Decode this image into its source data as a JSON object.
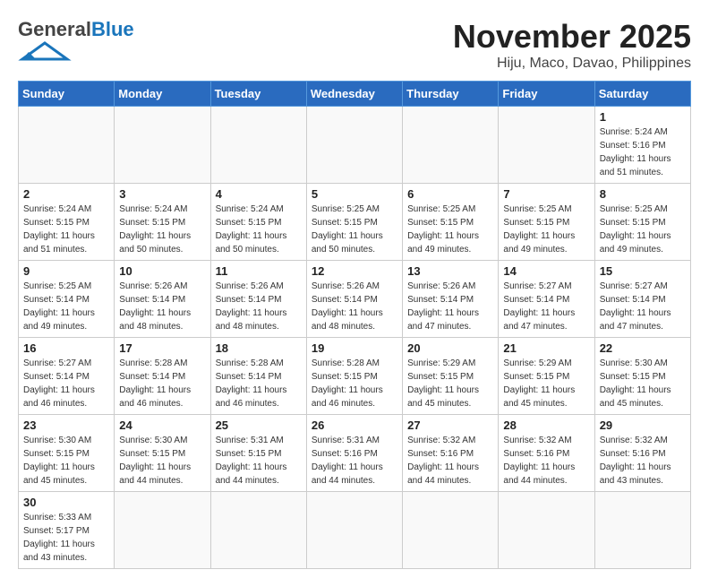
{
  "header": {
    "logo_general": "General",
    "logo_blue": "Blue",
    "month_title": "November 2025",
    "location": "Hiju, Maco, Davao, Philippines"
  },
  "weekdays": [
    "Sunday",
    "Monday",
    "Tuesday",
    "Wednesday",
    "Thursday",
    "Friday",
    "Saturday"
  ],
  "weeks": [
    [
      {
        "day": "",
        "info": ""
      },
      {
        "day": "",
        "info": ""
      },
      {
        "day": "",
        "info": ""
      },
      {
        "day": "",
        "info": ""
      },
      {
        "day": "",
        "info": ""
      },
      {
        "day": "",
        "info": ""
      },
      {
        "day": "1",
        "info": "Sunrise: 5:24 AM\nSunset: 5:16 PM\nDaylight: 11 hours\nand 51 minutes."
      }
    ],
    [
      {
        "day": "2",
        "info": "Sunrise: 5:24 AM\nSunset: 5:15 PM\nDaylight: 11 hours\nand 51 minutes."
      },
      {
        "day": "3",
        "info": "Sunrise: 5:24 AM\nSunset: 5:15 PM\nDaylight: 11 hours\nand 50 minutes."
      },
      {
        "day": "4",
        "info": "Sunrise: 5:24 AM\nSunset: 5:15 PM\nDaylight: 11 hours\nand 50 minutes."
      },
      {
        "day": "5",
        "info": "Sunrise: 5:25 AM\nSunset: 5:15 PM\nDaylight: 11 hours\nand 50 minutes."
      },
      {
        "day": "6",
        "info": "Sunrise: 5:25 AM\nSunset: 5:15 PM\nDaylight: 11 hours\nand 49 minutes."
      },
      {
        "day": "7",
        "info": "Sunrise: 5:25 AM\nSunset: 5:15 PM\nDaylight: 11 hours\nand 49 minutes."
      },
      {
        "day": "8",
        "info": "Sunrise: 5:25 AM\nSunset: 5:15 PM\nDaylight: 11 hours\nand 49 minutes."
      }
    ],
    [
      {
        "day": "9",
        "info": "Sunrise: 5:25 AM\nSunset: 5:14 PM\nDaylight: 11 hours\nand 49 minutes."
      },
      {
        "day": "10",
        "info": "Sunrise: 5:26 AM\nSunset: 5:14 PM\nDaylight: 11 hours\nand 48 minutes."
      },
      {
        "day": "11",
        "info": "Sunrise: 5:26 AM\nSunset: 5:14 PM\nDaylight: 11 hours\nand 48 minutes."
      },
      {
        "day": "12",
        "info": "Sunrise: 5:26 AM\nSunset: 5:14 PM\nDaylight: 11 hours\nand 48 minutes."
      },
      {
        "day": "13",
        "info": "Sunrise: 5:26 AM\nSunset: 5:14 PM\nDaylight: 11 hours\nand 47 minutes."
      },
      {
        "day": "14",
        "info": "Sunrise: 5:27 AM\nSunset: 5:14 PM\nDaylight: 11 hours\nand 47 minutes."
      },
      {
        "day": "15",
        "info": "Sunrise: 5:27 AM\nSunset: 5:14 PM\nDaylight: 11 hours\nand 47 minutes."
      }
    ],
    [
      {
        "day": "16",
        "info": "Sunrise: 5:27 AM\nSunset: 5:14 PM\nDaylight: 11 hours\nand 46 minutes."
      },
      {
        "day": "17",
        "info": "Sunrise: 5:28 AM\nSunset: 5:14 PM\nDaylight: 11 hours\nand 46 minutes."
      },
      {
        "day": "18",
        "info": "Sunrise: 5:28 AM\nSunset: 5:14 PM\nDaylight: 11 hours\nand 46 minutes."
      },
      {
        "day": "19",
        "info": "Sunrise: 5:28 AM\nSunset: 5:15 PM\nDaylight: 11 hours\nand 46 minutes."
      },
      {
        "day": "20",
        "info": "Sunrise: 5:29 AM\nSunset: 5:15 PM\nDaylight: 11 hours\nand 45 minutes."
      },
      {
        "day": "21",
        "info": "Sunrise: 5:29 AM\nSunset: 5:15 PM\nDaylight: 11 hours\nand 45 minutes."
      },
      {
        "day": "22",
        "info": "Sunrise: 5:30 AM\nSunset: 5:15 PM\nDaylight: 11 hours\nand 45 minutes."
      }
    ],
    [
      {
        "day": "23",
        "info": "Sunrise: 5:30 AM\nSunset: 5:15 PM\nDaylight: 11 hours\nand 45 minutes."
      },
      {
        "day": "24",
        "info": "Sunrise: 5:30 AM\nSunset: 5:15 PM\nDaylight: 11 hours\nand 44 minutes."
      },
      {
        "day": "25",
        "info": "Sunrise: 5:31 AM\nSunset: 5:15 PM\nDaylight: 11 hours\nand 44 minutes."
      },
      {
        "day": "26",
        "info": "Sunrise: 5:31 AM\nSunset: 5:16 PM\nDaylight: 11 hours\nand 44 minutes."
      },
      {
        "day": "27",
        "info": "Sunrise: 5:32 AM\nSunset: 5:16 PM\nDaylight: 11 hours\nand 44 minutes."
      },
      {
        "day": "28",
        "info": "Sunrise: 5:32 AM\nSunset: 5:16 PM\nDaylight: 11 hours\nand 44 minutes."
      },
      {
        "day": "29",
        "info": "Sunrise: 5:32 AM\nSunset: 5:16 PM\nDaylight: 11 hours\nand 43 minutes."
      }
    ],
    [
      {
        "day": "30",
        "info": "Sunrise: 5:33 AM\nSunset: 5:17 PM\nDaylight: 11 hours\nand 43 minutes."
      },
      {
        "day": "",
        "info": ""
      },
      {
        "day": "",
        "info": ""
      },
      {
        "day": "",
        "info": ""
      },
      {
        "day": "",
        "info": ""
      },
      {
        "day": "",
        "info": ""
      },
      {
        "day": "",
        "info": ""
      }
    ]
  ]
}
